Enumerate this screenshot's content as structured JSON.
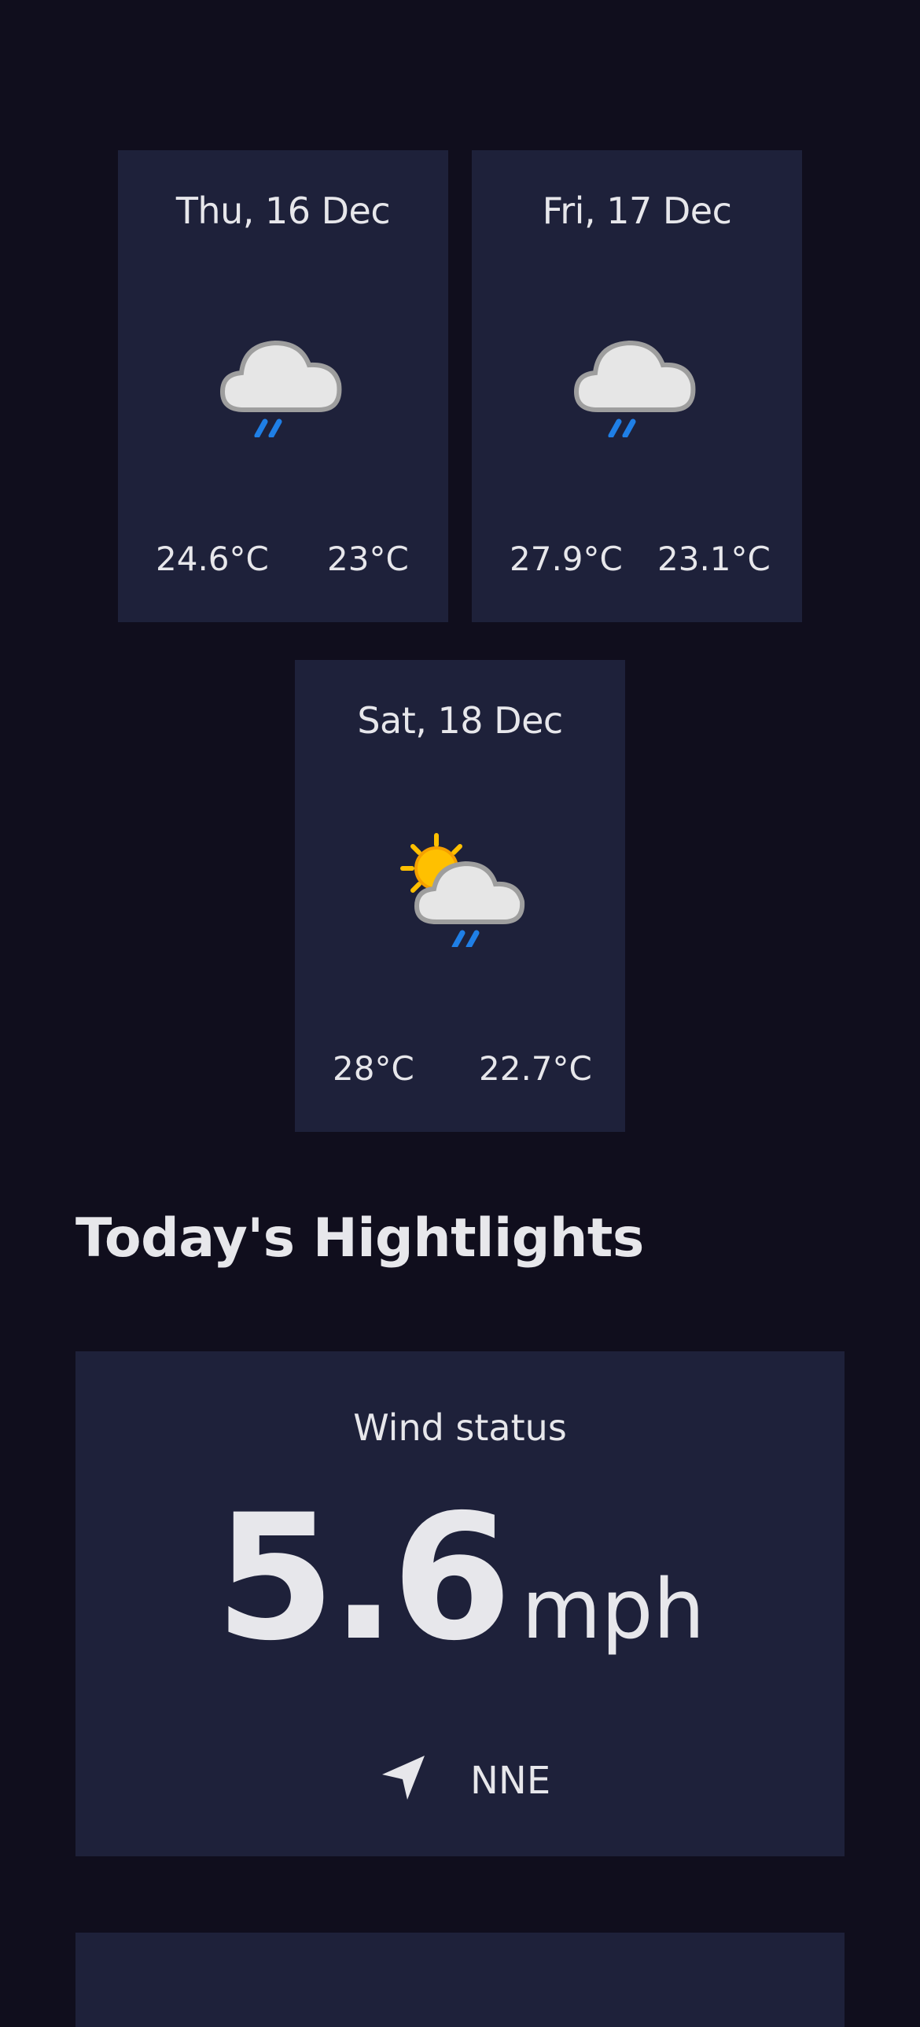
{
  "forecast": [
    {
      "date": "Thu, 16 Dec",
      "icon": "light-rain-icon",
      "max": "24.6°C",
      "min": "23°C"
    },
    {
      "date": "Fri, 17 Dec",
      "icon": "light-rain-icon",
      "max": "27.9°C",
      "min": "23.1°C"
    },
    {
      "date": "Sat, 18 Dec",
      "icon": "sun-cloud-rain-icon",
      "max": "28°C",
      "min": "22.7°C"
    }
  ],
  "highlights": {
    "heading": "Today's Hightlights",
    "wind": {
      "title": "Wind status",
      "value": "5.6",
      "unit": "mph",
      "direction": "NNE",
      "direction_icon": "navigation-arrow-icon"
    }
  },
  "colors": {
    "background": "#100e1d",
    "card": "#1e213a",
    "text": "#e7e7eb",
    "rain": "#1f7fe6",
    "sun": "#ffc000"
  }
}
